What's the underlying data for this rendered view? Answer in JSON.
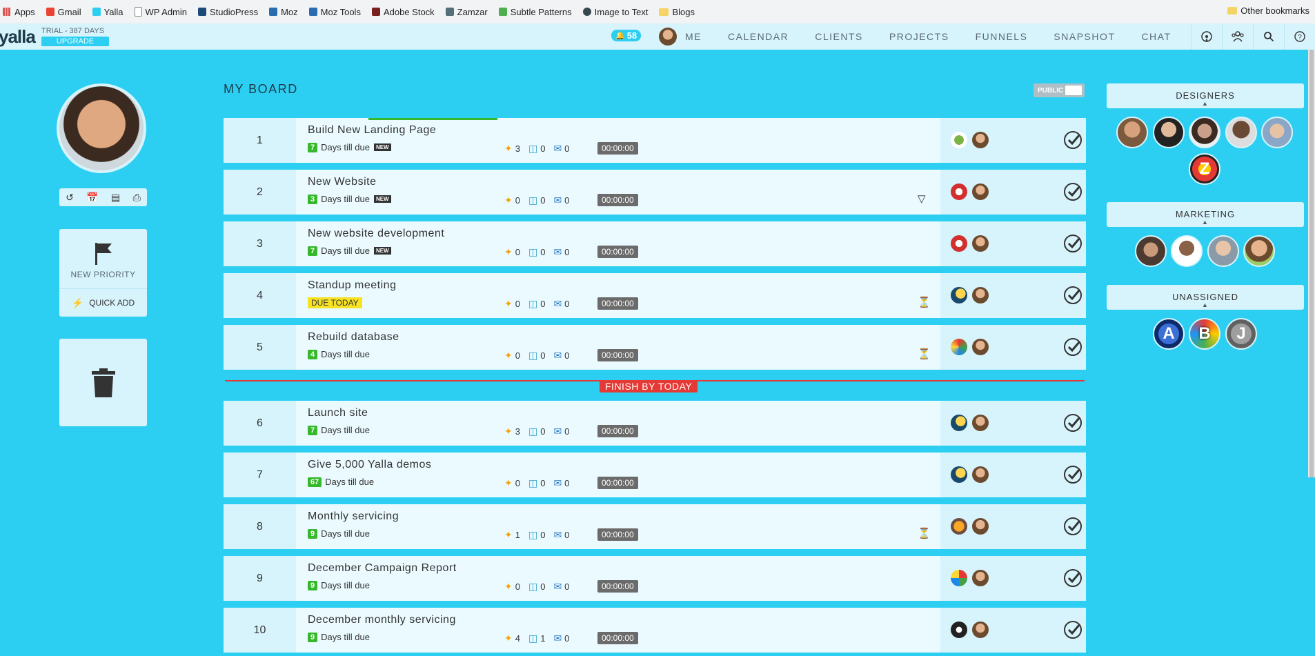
{
  "bookmarks": [
    "Apps",
    "Gmail",
    "Yalla",
    "WP Admin",
    "StudioPress",
    "Moz",
    "Moz Tools",
    "Adobe Stock",
    "Zamzar",
    "Subtle Patterns",
    "Image to Text",
    "Blogs"
  ],
  "bookmarks_other": "Other bookmarks",
  "header": {
    "logo": "yalla",
    "trial": "TRIAL - 387 DAYS",
    "upgrade": "UPGRADE",
    "notifications": "58",
    "nav": [
      "ME",
      "CALENDAR",
      "CLIENTS",
      "PROJECTS",
      "FUNNELS",
      "SNAPSHOT",
      "CHAT"
    ]
  },
  "sidebar": {
    "new_priority": "NEW PRIORITY",
    "quick_add": "QUICK ADD"
  },
  "board": {
    "title": "MY BOARD",
    "public_label": "PUBLIC",
    "deadline_label": "FINISH BY TODAY",
    "tasks": [
      {
        "num": "1",
        "title": "Build New Landing Page",
        "days": "7",
        "days_text": "Days till due",
        "new": "NEW",
        "pins": "3",
        "files": "0",
        "comments": "0",
        "timer": "00:00:00",
        "progress": 0.2
      },
      {
        "num": "2",
        "title": "New Website",
        "days": "3",
        "days_text": "Days till due",
        "new": "NEW",
        "pins": "0",
        "files": "0",
        "comments": "0",
        "timer": "00:00:00"
      },
      {
        "num": "3",
        "title": "New website development",
        "days": "7",
        "days_text": "Days till due",
        "new": "NEW",
        "pins": "0",
        "files": "0",
        "comments": "0",
        "timer": "00:00:00"
      },
      {
        "num": "4",
        "title": "Standup meeting",
        "due_today": "DUE TODAY",
        "pins": "0",
        "files": "0",
        "comments": "0",
        "timer": "00:00:00"
      },
      {
        "num": "5",
        "title": "Rebuild database",
        "days": "4",
        "days_text": "Days till due",
        "pins": "0",
        "files": "0",
        "comments": "0",
        "timer": "00:00:00"
      },
      {
        "num": "6",
        "title": "Launch site",
        "days": "7",
        "days_text": "Days till due",
        "pins": "3",
        "files": "0",
        "comments": "0",
        "timer": "00:00:00"
      },
      {
        "num": "7",
        "title": "Give 5,000 Yalla demos",
        "days": "67",
        "days_text": "Days till due",
        "pins": "0",
        "files": "0",
        "comments": "0",
        "timer": "00:00:00"
      },
      {
        "num": "8",
        "title": "Monthly servicing",
        "days": "9",
        "days_text": "Days till due",
        "pins": "1",
        "files": "0",
        "comments": "0",
        "timer": "00:00:00"
      },
      {
        "num": "9",
        "title": "December Campaign Report",
        "days": "9",
        "days_text": "Days till due",
        "pins": "0",
        "files": "0",
        "comments": "0",
        "timer": "00:00:00"
      },
      {
        "num": "10",
        "title": "December monthly servicing",
        "days": "9",
        "days_text": "Days till due",
        "pins": "4",
        "files": "1",
        "comments": "0",
        "timer": "00:00:00"
      }
    ]
  },
  "groups": {
    "designers": "DESIGNERS",
    "marketing": "MARKETING",
    "unassigned": "UNASSIGNED",
    "unassigned_letters": [
      "A",
      "B",
      "J"
    ],
    "designer_letter": "Z"
  },
  "colors": {
    "background": "#2ccff2",
    "panel": "#d7f3fb",
    "green": "#35b82a",
    "red": "#e53935"
  }
}
